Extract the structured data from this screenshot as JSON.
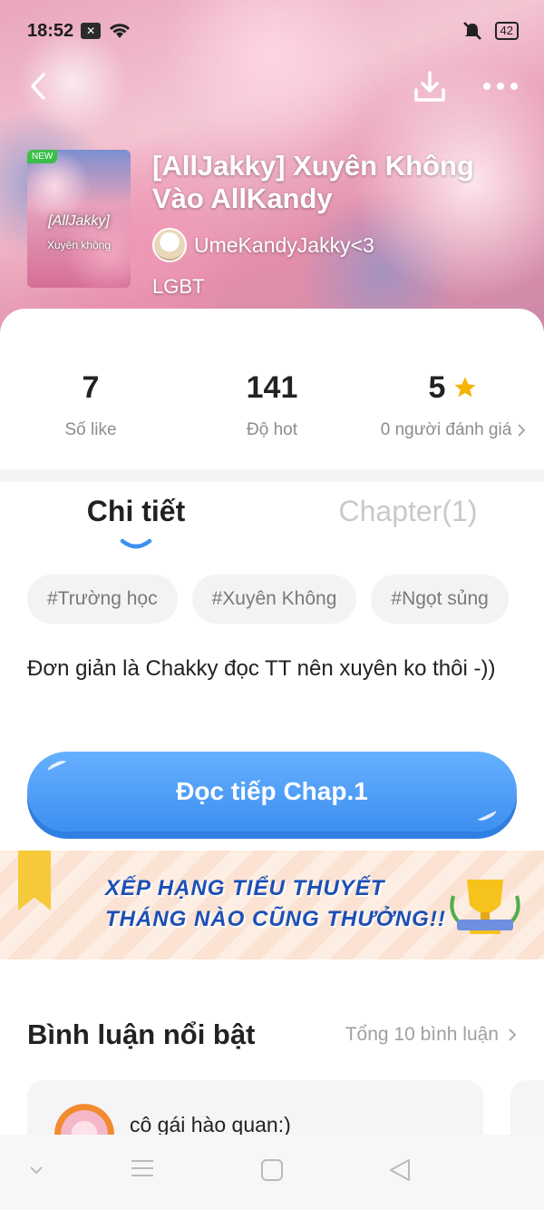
{
  "status_bar": {
    "time": "18:52",
    "battery": "42"
  },
  "book": {
    "cover": {
      "badge": "NEW",
      "title": "[AllJakky]",
      "subtitle": "Xuyên không"
    },
    "title": "[AllJakky] Xuyên Không Vào AllKandy",
    "author": "UmeKandyJakky<3",
    "category": "LGBT"
  },
  "stats": {
    "likes": {
      "value": "7",
      "label": "Số like"
    },
    "hot": {
      "value": "141",
      "label": "Độ hot"
    },
    "rating": {
      "value": "5",
      "label": "0 người đánh giá"
    }
  },
  "tabs": {
    "details": "Chi tiết",
    "chapters": "Chapter(1)"
  },
  "tags": [
    "#Trường học",
    "#Xuyên Không",
    "#Ngọt sủng"
  ],
  "description": "Đơn giản là Chakky đọc TT nên xuyên ko thôi -))",
  "read_button": "Đọc tiếp Chap.1",
  "banner": {
    "line1": "XẾP HẠNG TIỂU THUYẾT",
    "line2": "THÁNG NÀO CŨNG THƯỞNG!!"
  },
  "comments": {
    "title": "Bình luận nổi bật",
    "count": "Tổng 10 bình luận",
    "first_user": "cô gái hào quan:)"
  },
  "colors": {
    "accent": "#3d8ff0",
    "star": "#f5b400",
    "muted": "#8d8d8d"
  }
}
